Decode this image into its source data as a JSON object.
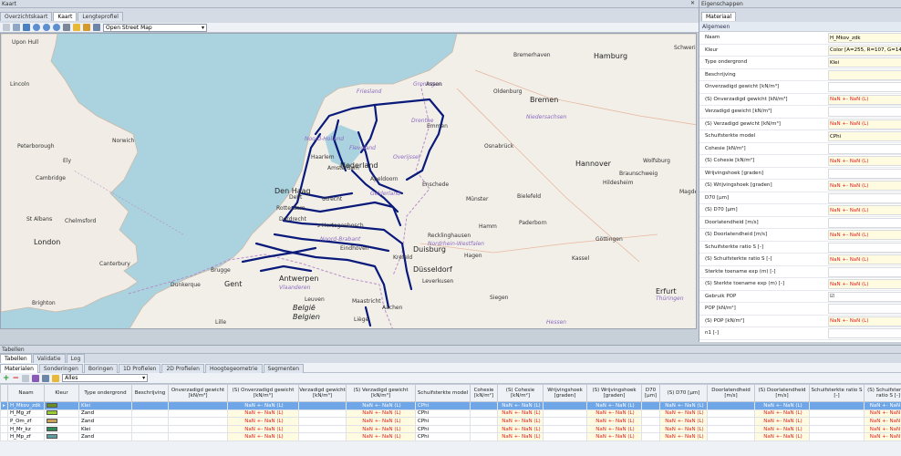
{
  "map_window": {
    "title": "Kaart",
    "tabs": [
      "Overzichtskaart",
      "Kaart",
      "Lengteprofiel"
    ],
    "selected_tab": "Kaart",
    "basemap": "Open Street Map",
    "labels": [
      "Upon Hull",
      "Lincoln",
      "Peterborough",
      "Norwich",
      "Ely",
      "Cambridge",
      "St Albans",
      "Chelmsford",
      "London",
      "Canterbury",
      "Brighton",
      "Dunkerque",
      "Brugge",
      "Gent",
      "Antwerpen",
      "Vlaanderen",
      "Leuven",
      "België",
      "Belgien",
      "Liège",
      "Lille",
      "Maastricht",
      "Aachen",
      "Eindhoven",
      "Noord-Brabant",
      "Den Haag",
      "Delft",
      "Rotterdam",
      "Dordrecht",
      "'s-Hertogenbosch",
      "Utrecht",
      "Amsterdam",
      "Noord-Holland",
      "Haarlem",
      "Apeldoorn",
      "Enschede",
      "Overijssel",
      "Gelderland",
      "Flevoland",
      "Friesland",
      "Groningen",
      "Drenthe",
      "Emmen",
      "Assen",
      "Nederland",
      "Duisburg",
      "Düsseldorf",
      "Krefeld",
      "Leverkusen",
      "Siegen",
      "Hagen",
      "Hamm",
      "Recklinghausen",
      "Nordrhein-Westfalen",
      "Münster",
      "Bielefeld",
      "Paderborn",
      "Osnabrück",
      "Oldenburg",
      "Bremen",
      "Niedersachsen",
      "Bremerhaven",
      "Hamburg",
      "Hannover",
      "Braunschweig",
      "Wolfsburg",
      "Hildesheim",
      "Göttingen",
      "Kassel",
      "Erfurt",
      "Thüringen",
      "Hessen",
      "Magdeburg",
      "Schwerin"
    ]
  },
  "properties": {
    "title": "Eigenschappen",
    "tab": "Materiaal",
    "section": "Algemeen",
    "rows": [
      {
        "label": "Naam",
        "value": "H_Mkov_zdk",
        "style": "yl"
      },
      {
        "label": "Kleur",
        "value": "Color [A=255, R=107, G=142, B=35]",
        "style": "yl"
      },
      {
        "label": "Type ondergrond",
        "value": "Klei",
        "style": "yl"
      },
      {
        "label": "Beschrijving",
        "value": "",
        "style": "yl"
      },
      {
        "label": "Onverzadigd gewicht [kN/m³]",
        "value": "",
        "style": ""
      },
      {
        "label": "(S) Onverzadigd gewicht [kN/m³]",
        "value": "NaN +- NaN (L)",
        "style": "yl red"
      },
      {
        "label": "Verzadigd gewicht [kN/m³]",
        "value": "",
        "style": ""
      },
      {
        "label": "(S) Verzadigd gewicht [kN/m³]",
        "value": "NaN +- NaN (L)",
        "style": "yl red"
      },
      {
        "label": "Schuifsterkte model",
        "value": "CPhi",
        "style": "yl"
      },
      {
        "label": "Cohesie [kN/m²]",
        "value": "",
        "style": ""
      },
      {
        "label": "(S) Cohesie [kN/m²]",
        "value": "NaN +- NaN (L)",
        "style": "yl red"
      },
      {
        "label": "Wrijvingshoek [graden]",
        "value": "",
        "style": ""
      },
      {
        "label": "(S) Wrijvingshoek [graden]",
        "value": "NaN +- NaN (L)",
        "style": "yl red"
      },
      {
        "label": "D70 [µm]",
        "value": "",
        "style": ""
      },
      {
        "label": "(S) D70 [µm]",
        "value": "NaN +- NaN (L)",
        "style": "yl red"
      },
      {
        "label": "Doorlatendheid [m/s]",
        "value": "",
        "style": ""
      },
      {
        "label": "(S) Doorlatendheid [m/s]",
        "value": "NaN +- NaN (L)",
        "style": "yl red"
      },
      {
        "label": "Schuifsterkte ratio S [-]",
        "value": "",
        "style": ""
      },
      {
        "label": "(S) Schuifsterkte ratio S [-]",
        "value": "NaN +- NaN (L)",
        "style": "yl red"
      },
      {
        "label": "Sterkte toename exp (m) [-]",
        "value": "",
        "style": ""
      },
      {
        "label": "(S) Sterkte toename exp (m) [-]",
        "value": "NaN +- NaN (L)",
        "style": "yl red"
      },
      {
        "label": "Gebruik POP",
        "value": "☑",
        "style": ""
      },
      {
        "label": "POP [kN/m²]",
        "value": "",
        "style": ""
      },
      {
        "label": "(S) POP [kN/m²]",
        "value": "NaN +- NaN (L)",
        "style": "yl red"
      },
      {
        "label": "n1 [-]",
        "value": "",
        "style": ""
      }
    ]
  },
  "tables": {
    "title": "Tabellen",
    "top_tabs": [
      "Tabellen",
      "Validatie",
      "Log"
    ],
    "tabs": [
      "Materialen",
      "Sonderingen",
      "Boringen",
      "1D Profielen",
      "2D Profielen",
      "Hoogtegeometrie",
      "Segmenten"
    ],
    "filter": "Alles",
    "columns": [
      "",
      "Naam",
      "Kleur",
      "Type ondergrond",
      "Beschrijving",
      "Onverzadigd gewicht [kN/m³]",
      "(S) Onverzadigd gewicht [kN/m³]",
      "Verzadigd gewicht [kN/m³]",
      "(S) Verzadigd gewicht [kN/m³]",
      "Schuifsterkte model",
      "Cohesie [kN/m²]",
      "(S) Cohesie [kN/m²]",
      "Wrijvingshoek [graden]",
      "(S) Wrijvingshoek [graden]",
      "D70 [µm]",
      "(S) D70 [µm]",
      "Doorlatendheid [m/s]",
      "(S) Doorlatendheid [m/s]",
      "Schuifsterkte ratio S [-]",
      "(S) Schuifsterkte ratio S [-]"
    ],
    "nan": "NaN +- NaN (L)",
    "rows": [
      {
        "name": "H_Mkov_zdk",
        "color": "#6b8e23",
        "type": "Klei",
        "model": "CPhi"
      },
      {
        "name": "H_Mg_zf",
        "color": "#9acd32",
        "type": "Zand",
        "model": "CPhi"
      },
      {
        "name": "P_Om_zf",
        "color": "#c8a05a",
        "type": "Zand",
        "model": "CPhi"
      },
      {
        "name": "H_Mr_kz",
        "color": "#2e8b57",
        "type": "Klei",
        "model": "CPhi"
      },
      {
        "name": "H_Mp_zf",
        "color": "#5f9ea0",
        "type": "Zand",
        "model": "CPhi"
      }
    ]
  }
}
